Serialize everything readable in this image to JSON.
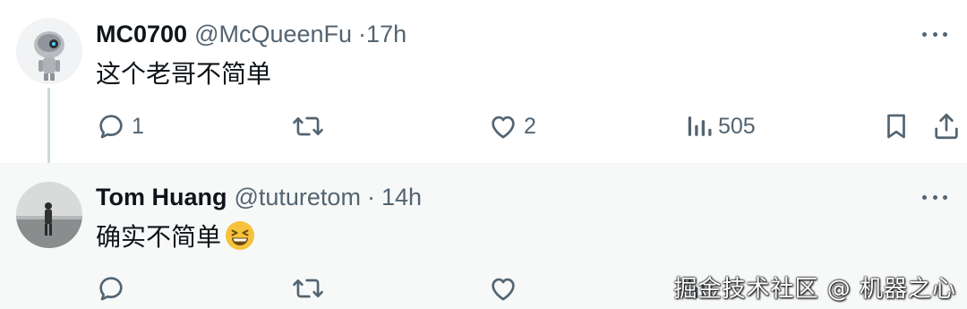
{
  "tweets": [
    {
      "name": "MC0700",
      "handle": "@McQueenFu",
      "separator": "·",
      "time": "17h",
      "text": "这个老哥不简单",
      "replies": "1",
      "retweets": "",
      "likes": "2",
      "views": "505"
    },
    {
      "name": "Tom Huang",
      "handle": "@tuturetom",
      "separator": "·",
      "time": "14h",
      "text": "确实不简单",
      "emoji": "grinning-squinting-face",
      "replies": "",
      "retweets": "",
      "likes": "",
      "views": ""
    }
  ],
  "watermark": "掘金技术社区 @ 机器之心",
  "colors": {
    "text": "#0f1419",
    "secondary": "#536471",
    "thread_line": "#cfd9de",
    "hover_background": "#f7f9f9",
    "emoji": "#f6c23b"
  },
  "icons": [
    "reply-icon",
    "retweet-icon",
    "like-icon",
    "views-icon",
    "bookmark-icon",
    "share-icon",
    "more-icon"
  ]
}
